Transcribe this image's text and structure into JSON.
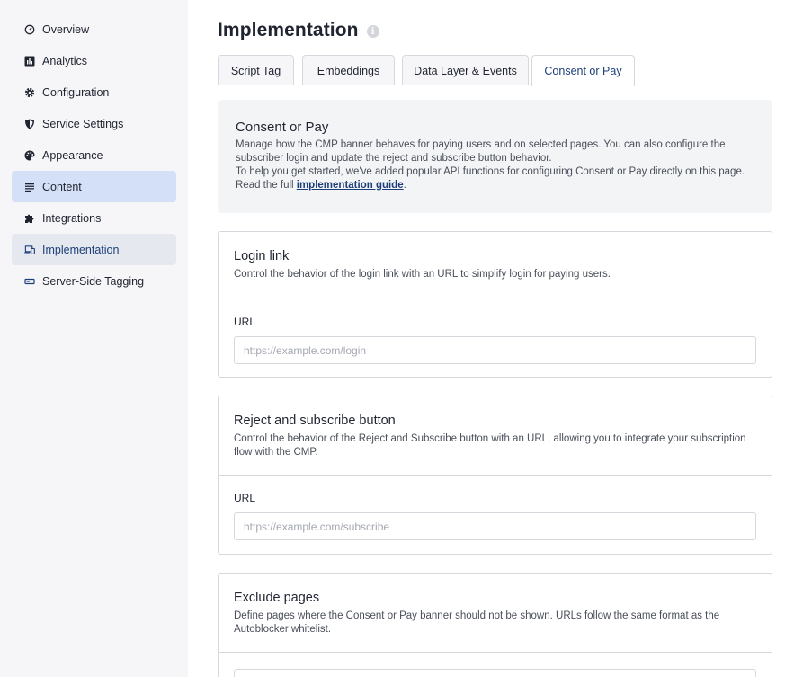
{
  "sidebar": {
    "items": [
      {
        "label": "Overview",
        "icon": "gauge-icon"
      },
      {
        "label": "Analytics",
        "icon": "bar-chart-icon"
      },
      {
        "label": "Configuration",
        "icon": "gear-icon"
      },
      {
        "label": "Service Settings",
        "icon": "shield-icon"
      },
      {
        "label": "Appearance",
        "icon": "palette-icon"
      },
      {
        "label": "Content",
        "icon": "lines-icon"
      },
      {
        "label": "Integrations",
        "icon": "puzzle-icon"
      },
      {
        "label": "Implementation",
        "icon": "devices-icon"
      },
      {
        "label": "Server-Side Tagging",
        "icon": "server-icon"
      }
    ]
  },
  "header": {
    "title": "Implementation"
  },
  "tabs": [
    {
      "label": "Script Tag"
    },
    {
      "label": "Embeddings"
    },
    {
      "label": "Data Layer & Events"
    },
    {
      "label": "Consent or Pay"
    }
  ],
  "intro": {
    "title": "Consent or Pay",
    "line1": "Manage how the CMP banner behaves for paying users and on selected pages. You can also configure the subscriber login and update the reject and subscribe button behavior.",
    "line2_prefix": "To help you get started, we've added popular API functions for configuring Consent or Pay directly on this page. Read the full ",
    "link_text": "implementation guide",
    "line2_suffix": "."
  },
  "login_card": {
    "title": "Login link",
    "description": "Control the behavior of the login link with an URL to simplify login for paying users.",
    "field_label": "URL",
    "placeholder": "https://example.com/login",
    "value": ""
  },
  "subscribe_card": {
    "title": "Reject and subscribe button",
    "description": "Control the behavior of the Reject and Subscribe button with an URL, allowing you to integrate your subscription flow with the CMP.",
    "field_label": "URL",
    "placeholder": "https://example.com/subscribe",
    "value": ""
  },
  "exclude_card": {
    "title": "Exclude pages",
    "description": "Define pages where the Consent or Pay banner should not be shown. URLs follow the same format as the Autoblocker whitelist."
  },
  "colors": {
    "accent": "#1c3f7a",
    "sidebar_bg": "#f6f6f8",
    "hover_bg": "#d4e0f8",
    "active_bg": "#e6e8ef",
    "border": "#d6d8de"
  }
}
